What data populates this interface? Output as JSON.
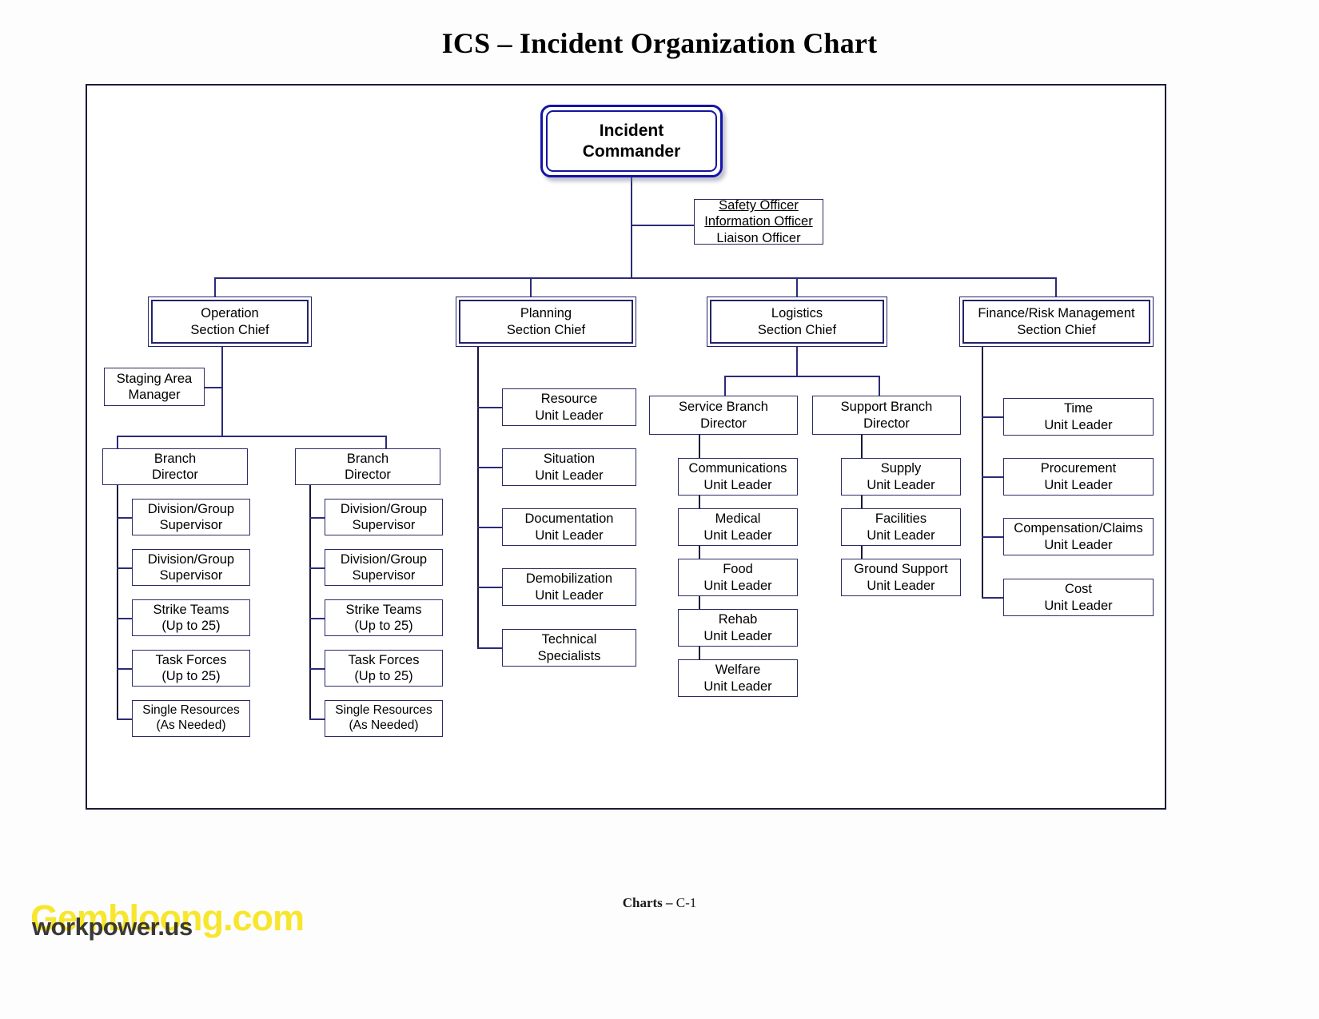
{
  "title": "ICS – Incident Organization Chart",
  "footer": {
    "bold": "Charts –",
    "rest": " C-1"
  },
  "watermarks": {
    "primary": "Gembloong.com",
    "secondary": "workpower.us"
  },
  "colors": {
    "frame_border": "#1b1b38",
    "node_border": "#2b2b66",
    "connector": "#2b2b78",
    "commander_border": "#1414a5",
    "watermark_yellow": "#f7e62e"
  },
  "chart_data": {
    "type": "diagram",
    "title": "ICS – Incident Organization Chart",
    "root": "Incident Commander",
    "nodes": {
      "incident_commander": {
        "lines": [
          "Incident",
          "Commander"
        ]
      },
      "command_staff": {
        "lines": [
          "Safety Officer",
          "Information Officer",
          "Liaison Officer"
        ],
        "underlined": [
          true,
          true,
          false
        ]
      },
      "operations_chief": {
        "lines": [
          "Operation",
          "Section Chief"
        ]
      },
      "planning_chief": {
        "lines": [
          "Planning",
          "Section Chief"
        ]
      },
      "logistics_chief": {
        "lines": [
          "Logistics",
          "Section Chief"
        ]
      },
      "finance_chief": {
        "lines": [
          "Finance/Risk Management",
          "Section Chief"
        ]
      },
      "staging_area_manager": {
        "lines": [
          "Staging Area",
          "Manager"
        ]
      },
      "branch_director_1": {
        "lines": [
          "Branch",
          "Director"
        ]
      },
      "branch_director_2": {
        "lines": [
          "Branch",
          "Director"
        ]
      },
      "ops1_division_supervisor_1": {
        "lines": [
          "Division/Group",
          "Supervisor"
        ]
      },
      "ops1_division_supervisor_2": {
        "lines": [
          "Division/Group",
          "Supervisor"
        ]
      },
      "ops1_strike_teams": {
        "lines": [
          "Strike Teams",
          "(Up to 25)"
        ]
      },
      "ops1_task_forces": {
        "lines": [
          "Task Forces",
          "(Up to 25)"
        ]
      },
      "ops1_single_resources": {
        "lines": [
          "Single Resources",
          "(As Needed)"
        ]
      },
      "ops2_division_supervisor_1": {
        "lines": [
          "Division/Group",
          "Supervisor"
        ]
      },
      "ops2_division_supervisor_2": {
        "lines": [
          "Division/Group",
          "Supervisor"
        ]
      },
      "ops2_strike_teams": {
        "lines": [
          "Strike Teams",
          "(Up to 25)"
        ]
      },
      "ops2_task_forces": {
        "lines": [
          "Task Forces",
          "(Up to 25)"
        ]
      },
      "ops2_single_resources": {
        "lines": [
          "Single Resources",
          "(As Needed)"
        ]
      },
      "planning_resource": {
        "lines": [
          "Resource",
          "Unit Leader"
        ]
      },
      "planning_situation": {
        "lines": [
          "Situation",
          "Unit Leader"
        ]
      },
      "planning_documentation": {
        "lines": [
          "Documentation",
          "Unit Leader"
        ]
      },
      "planning_demobilization": {
        "lines": [
          "Demobilization",
          "Unit Leader"
        ]
      },
      "planning_technical": {
        "lines": [
          "Technical",
          "Specialists"
        ]
      },
      "service_branch_director": {
        "lines": [
          "Service Branch",
          "Director"
        ]
      },
      "support_branch_director": {
        "lines": [
          "Support Branch",
          "Director"
        ]
      },
      "service_communications": {
        "lines": [
          "Communications",
          "Unit Leader"
        ]
      },
      "service_medical": {
        "lines": [
          "Medical",
          "Unit Leader"
        ]
      },
      "service_food": {
        "lines": [
          "Food",
          "Unit Leader"
        ]
      },
      "service_rehab": {
        "lines": [
          "Rehab",
          "Unit Leader"
        ]
      },
      "service_welfare": {
        "lines": [
          "Welfare",
          "Unit Leader"
        ]
      },
      "support_supply": {
        "lines": [
          "Supply",
          "Unit Leader"
        ]
      },
      "support_facilities": {
        "lines": [
          "Facilities",
          "Unit Leader"
        ]
      },
      "support_ground": {
        "lines": [
          "Ground Support",
          "Unit Leader"
        ]
      },
      "finance_time": {
        "lines": [
          "Time",
          "Unit Leader"
        ]
      },
      "finance_procurement": {
        "lines": [
          "Procurement",
          "Unit Leader"
        ]
      },
      "finance_compensation": {
        "lines": [
          "Compensation/Claims",
          "Unit Leader"
        ]
      },
      "finance_cost": {
        "lines": [
          "Cost",
          "Unit Leader"
        ]
      }
    },
    "edges": [
      [
        "incident_commander",
        "command_staff"
      ],
      [
        "incident_commander",
        "operations_chief"
      ],
      [
        "incident_commander",
        "planning_chief"
      ],
      [
        "incident_commander",
        "logistics_chief"
      ],
      [
        "incident_commander",
        "finance_chief"
      ],
      [
        "operations_chief",
        "staging_area_manager"
      ],
      [
        "operations_chief",
        "branch_director_1"
      ],
      [
        "operations_chief",
        "branch_director_2"
      ],
      [
        "branch_director_1",
        "ops1_division_supervisor_1"
      ],
      [
        "branch_director_1",
        "ops1_division_supervisor_2"
      ],
      [
        "branch_director_1",
        "ops1_strike_teams"
      ],
      [
        "branch_director_1",
        "ops1_task_forces"
      ],
      [
        "branch_director_1",
        "ops1_single_resources"
      ],
      [
        "branch_director_2",
        "ops2_division_supervisor_1"
      ],
      [
        "branch_director_2",
        "ops2_division_supervisor_2"
      ],
      [
        "branch_director_2",
        "ops2_strike_teams"
      ],
      [
        "branch_director_2",
        "ops2_task_forces"
      ],
      [
        "branch_director_2",
        "ops2_single_resources"
      ],
      [
        "planning_chief",
        "planning_resource"
      ],
      [
        "planning_chief",
        "planning_situation"
      ],
      [
        "planning_chief",
        "planning_documentation"
      ],
      [
        "planning_chief",
        "planning_demobilization"
      ],
      [
        "planning_chief",
        "planning_technical"
      ],
      [
        "logistics_chief",
        "service_branch_director"
      ],
      [
        "logistics_chief",
        "support_branch_director"
      ],
      [
        "service_branch_director",
        "service_communications"
      ],
      [
        "service_branch_director",
        "service_medical"
      ],
      [
        "service_branch_director",
        "service_food"
      ],
      [
        "service_branch_director",
        "service_rehab"
      ],
      [
        "service_branch_director",
        "service_welfare"
      ],
      [
        "support_branch_director",
        "support_supply"
      ],
      [
        "support_branch_director",
        "support_facilities"
      ],
      [
        "support_branch_director",
        "support_ground"
      ],
      [
        "finance_chief",
        "finance_time"
      ],
      [
        "finance_chief",
        "finance_procurement"
      ],
      [
        "finance_chief",
        "finance_compensation"
      ],
      [
        "finance_chief",
        "finance_cost"
      ]
    ]
  }
}
